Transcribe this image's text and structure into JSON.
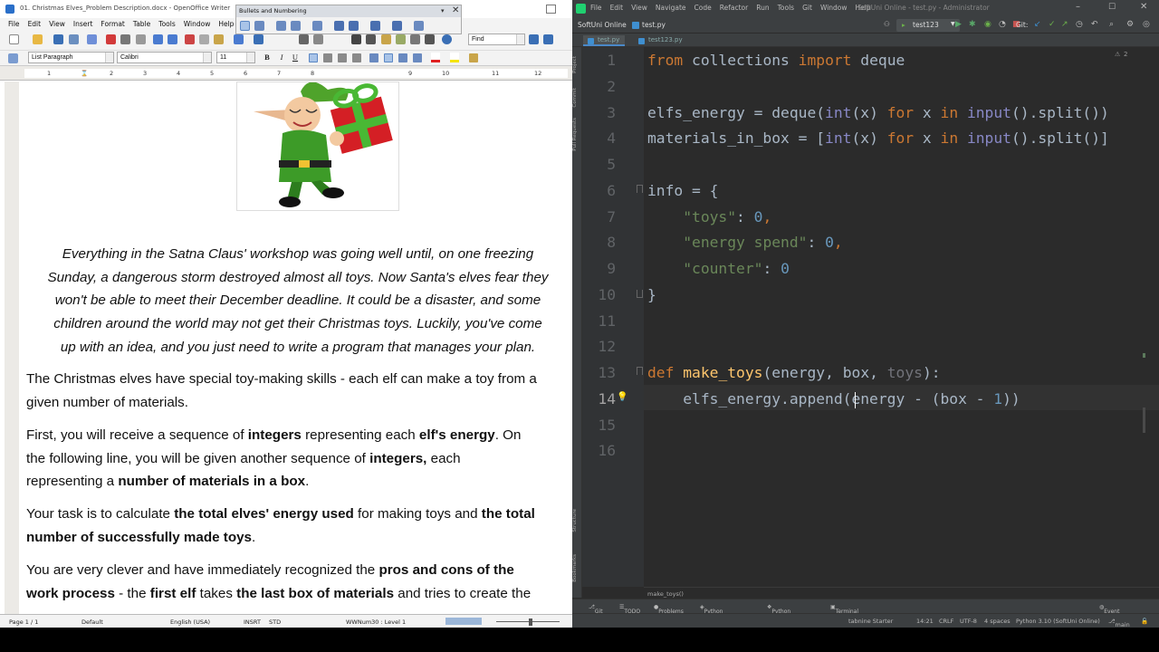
{
  "writer": {
    "title": "01. Christmas Elves_Problem Description.docx - OpenOffice Writer",
    "menu": [
      "File",
      "Edit",
      "View",
      "Insert",
      "Format",
      "Table",
      "Tools",
      "Window",
      "Help"
    ],
    "style_value": "List Paragraph",
    "font_value": "Calibri",
    "size_value": "11",
    "find_placeholder": "Find",
    "format_buttons": [
      "B",
      "I",
      "U"
    ],
    "bullets_panel_title": "Bullets and Numbering",
    "ruler_marks": [
      "1",
      "2",
      "3",
      "4",
      "5",
      "6",
      "7",
      "8",
      "9",
      "10",
      "11",
      "12"
    ],
    "intro_lines": [
      "Everything in the Satna Claus' workshop was going well until, on one freezing",
      "Sunday, a dangerous storm destroyed almost all toys. Now Santa's elves fear they",
      "won't be able to meet their December deadline. It could be a disaster, and some",
      "children around the world may not get their Christmas toys. Luckily, you've come",
      "up with an idea, and you just need to write a program that manages your plan."
    ],
    "p1": [
      "The Christmas elves have special toy-making skills - each elf can make a toy from a",
      "given number of materials."
    ],
    "p2": {
      "l1a": "First, you will receive a sequence of ",
      "l1b": "integers",
      "l1c": " representing each ",
      "l1d": "elf's energy",
      "l1e": ". On",
      "l2a": "the following line, you will be given another sequence of ",
      "l2b": "integers,",
      "l2c": " each",
      "l3a": "representing a ",
      "l3b": "number of materials in a box",
      "l3c": "."
    },
    "p3": {
      "l1a": "Your task is to calculate ",
      "l1b": "the total elves' energy used",
      "l1c": " for making toys and ",
      "l1d": "the total",
      "l2a": "number of successfully made toys",
      "l2b": "."
    },
    "p4": {
      "l1a": "You are very clever and have immediately recognized the ",
      "l1b": "pros and cons of the",
      "l2a": "work process",
      "l2b": " - the ",
      "l2c": "first elf",
      "l2d": " takes ",
      "l2e": "the last box of materials",
      "l2f": " and tries to create the"
    },
    "status": {
      "page": "Page 1 / 1",
      "style": "Default",
      "lang": "English (USA)",
      "insrt": "INSRT",
      "std": "STD",
      "level": "WWNum30 : Level 1"
    }
  },
  "pycharm": {
    "title": "SoftUni Online - test.py - Administrator",
    "menu": [
      "File",
      "Edit",
      "View",
      "Navigate",
      "Code",
      "Refactor",
      "Run",
      "Tools",
      "Git",
      "Window",
      "Help"
    ],
    "project": "SoftUni Online",
    "file": "test.py",
    "run_config": "test123",
    "git_label": "Git:",
    "tabs": [
      "test.py",
      "test123.py"
    ],
    "inspection_count": "2",
    "line_numbers": [
      "1",
      "2",
      "3",
      "4",
      "5",
      "6",
      "7",
      "8",
      "9",
      "10",
      "11",
      "12",
      "13",
      "14",
      "15",
      "16"
    ],
    "code": {
      "l1a": "from",
      "l1b": " collections ",
      "l1c": "import",
      "l1d": " deque",
      "l3a": "elfs_energy = deque(",
      "l3b": "int",
      "l3c": "(x) ",
      "l3d": "for",
      "l3e": " x ",
      "l3f": "in",
      "l3g": " ",
      "l3h": "input",
      "l3i": "().split())",
      "l4a": "materials_in_box = [",
      "l4b": "int",
      "l4c": "(x) ",
      "l4d": "for",
      "l4e": " x ",
      "l4f": "in",
      "l4g": " ",
      "l4h": "input",
      "l4i": "().split()]",
      "l6": "info = {",
      "l7a": "    ",
      "l7b": "\"toys\"",
      "l7c": ": ",
      "l7d": "0",
      "l7e": ",",
      "l8a": "    ",
      "l8b": "\"energy spend\"",
      "l8c": ": ",
      "l8d": "0",
      "l8e": ",",
      "l9a": "    ",
      "l9b": "\"counter\"",
      "l9c": ": ",
      "l9d": "0",
      "l10": "}",
      "l13a": "def",
      "l13b": " ",
      "l13c": "make_toys",
      "l13d": "(",
      "l13e": "energy",
      "l13f": ", ",
      "l13g": "box",
      "l13h": ", ",
      "l13i": "toys",
      "l13j": "):",
      "l14a": "    elfs_energy.append(energy - (box - ",
      "l14b": "1",
      "l14c": "))"
    },
    "breadcrumb": "make_toys()",
    "side_tools": [
      "Project",
      "Commit",
      "Pull Requests",
      "Structure",
      "Bookmarks"
    ],
    "bottom_tools": [
      "Git",
      "TODO",
      "Problems",
      "Python Packages",
      "Python Console",
      "Terminal",
      "Event Log"
    ],
    "status": {
      "tabnine": "tabnine Starter",
      "pos": "14:21",
      "eol": "CRLF",
      "enc": "UTF-8",
      "indent": "4 spaces",
      "interp": "Python 3.10 (SoftUni Online)",
      "branch": "main"
    }
  }
}
